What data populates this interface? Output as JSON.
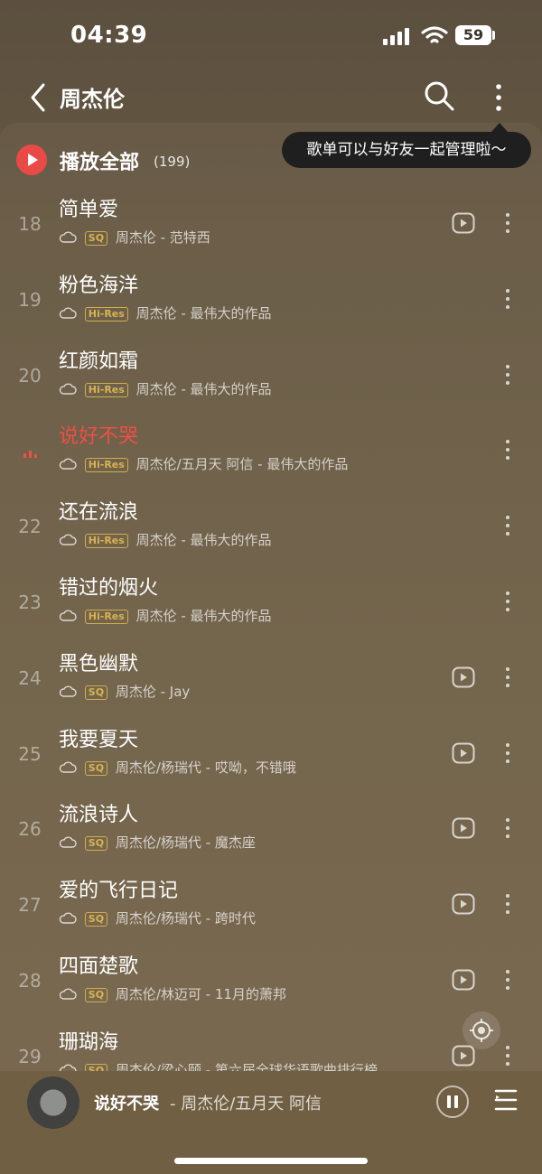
{
  "status_bar": {
    "time": "04:39",
    "battery": "59"
  },
  "header": {
    "title": "周杰伦"
  },
  "tooltip": {
    "text": "歌单可以与好友一起管理啦～"
  },
  "play_all": {
    "label": "播放全部",
    "count": "(199)"
  },
  "songs": [
    {
      "index": "18",
      "title": "简单爱",
      "badge": "SQ",
      "meta": "周杰伦 - 范特西",
      "has_mv": true,
      "playing": false
    },
    {
      "index": "19",
      "title": "粉色海洋",
      "badge": "Hi-Res",
      "meta": "周杰伦 - 最伟大的作品",
      "has_mv": false,
      "playing": false
    },
    {
      "index": "20",
      "title": "红颜如霜",
      "badge": "Hi-Res",
      "meta": "周杰伦 - 最伟大的作品",
      "has_mv": false,
      "playing": false
    },
    {
      "index": "",
      "title": "说好不哭",
      "badge": "Hi-Res",
      "meta": "周杰伦/五月天 阿信 - 最伟大的作品",
      "has_mv": false,
      "playing": true
    },
    {
      "index": "22",
      "title": "还在流浪",
      "badge": "Hi-Res",
      "meta": "周杰伦 - 最伟大的作品",
      "has_mv": false,
      "playing": false
    },
    {
      "index": "23",
      "title": "错过的烟火",
      "badge": "Hi-Res",
      "meta": "周杰伦 - 最伟大的作品",
      "has_mv": false,
      "playing": false
    },
    {
      "index": "24",
      "title": "黑色幽默",
      "badge": "SQ",
      "meta": "周杰伦 - Jay",
      "has_mv": true,
      "playing": false
    },
    {
      "index": "25",
      "title": "我要夏天",
      "badge": "SQ",
      "meta": "周杰伦/杨瑞代 - 哎呦，不错哦",
      "has_mv": true,
      "playing": false
    },
    {
      "index": "26",
      "title": "流浪诗人",
      "badge": "SQ",
      "meta": "周杰伦/杨瑞代 - 魔杰座",
      "has_mv": true,
      "playing": false
    },
    {
      "index": "27",
      "title": "爱的飞行日记",
      "badge": "SQ",
      "meta": "周杰伦/杨瑞代 - 跨时代",
      "has_mv": true,
      "playing": false
    },
    {
      "index": "28",
      "title": "四面楚歌",
      "badge": "SQ",
      "meta": "周杰伦/林迈可 - 11月的萧邦",
      "has_mv": true,
      "playing": false
    },
    {
      "index": "29",
      "title": "珊瑚海",
      "badge": "SQ",
      "meta": "周杰伦/梁心颐 - 第六届全球华语歌曲排行榜...",
      "has_mv": true,
      "playing": false
    }
  ],
  "mini_player": {
    "title": "说好不哭",
    "artist": " - 周杰伦/五月天 阿信"
  }
}
